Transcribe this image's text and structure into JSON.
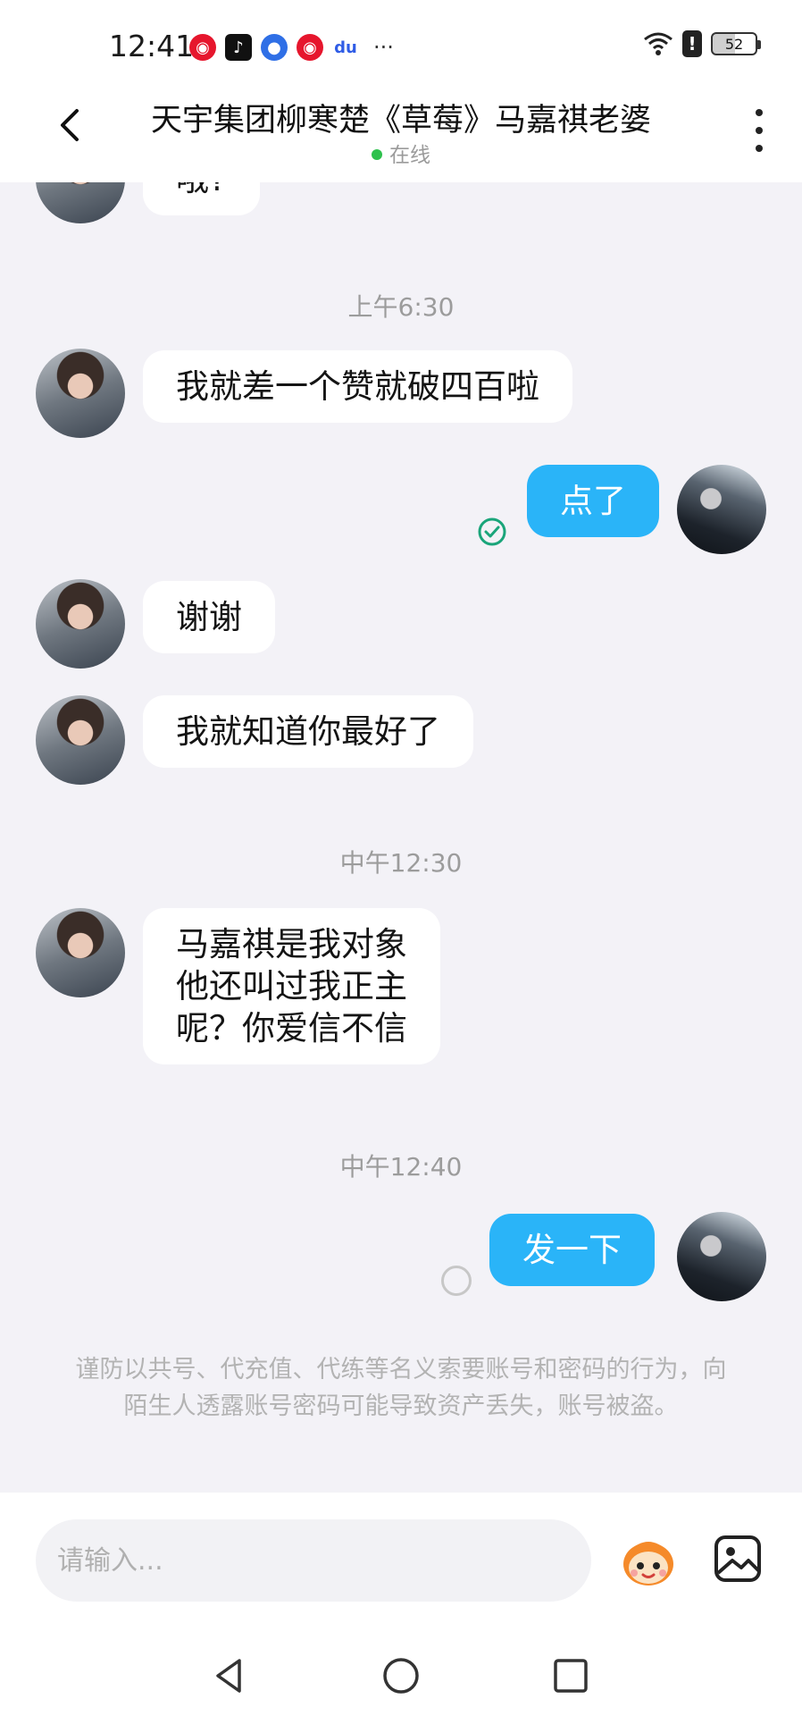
{
  "status_bar": {
    "time": "12:41",
    "battery": "52",
    "app_icons": [
      "weibo-icon",
      "tiktok-icon",
      "browser-icon",
      "weibo-icon",
      "baidu-icon"
    ],
    "more": "···"
  },
  "header": {
    "title": "天宇集团柳寒楚《草莓》马嘉祺老婆",
    "status": "在线"
  },
  "messages": {
    "partial": "哦?",
    "ts1": "上午6:30",
    "m1": "我就差一个赞就破四百啦",
    "m2": "点了",
    "m3": "谢谢",
    "m4": "我就知道你最好了",
    "ts2": "中午12:30",
    "m5_line1": "马嘉祺是我对象",
    "m5_line2": "他还叫过我正主",
    "m5_line3": "呢？你爱信不信",
    "ts3": "中午12:40",
    "m6": "发一下"
  },
  "notice": "谨防以共号、代充值、代练等名义索要账号和密码的行为，向陌生人透露账号密码可能导致资产丢失，账号被盗。",
  "input": {
    "placeholder": "请输入..."
  },
  "colors": {
    "accent": "#2ab4f8",
    "online": "#2ec14d",
    "read_check": "#1aa57a"
  }
}
